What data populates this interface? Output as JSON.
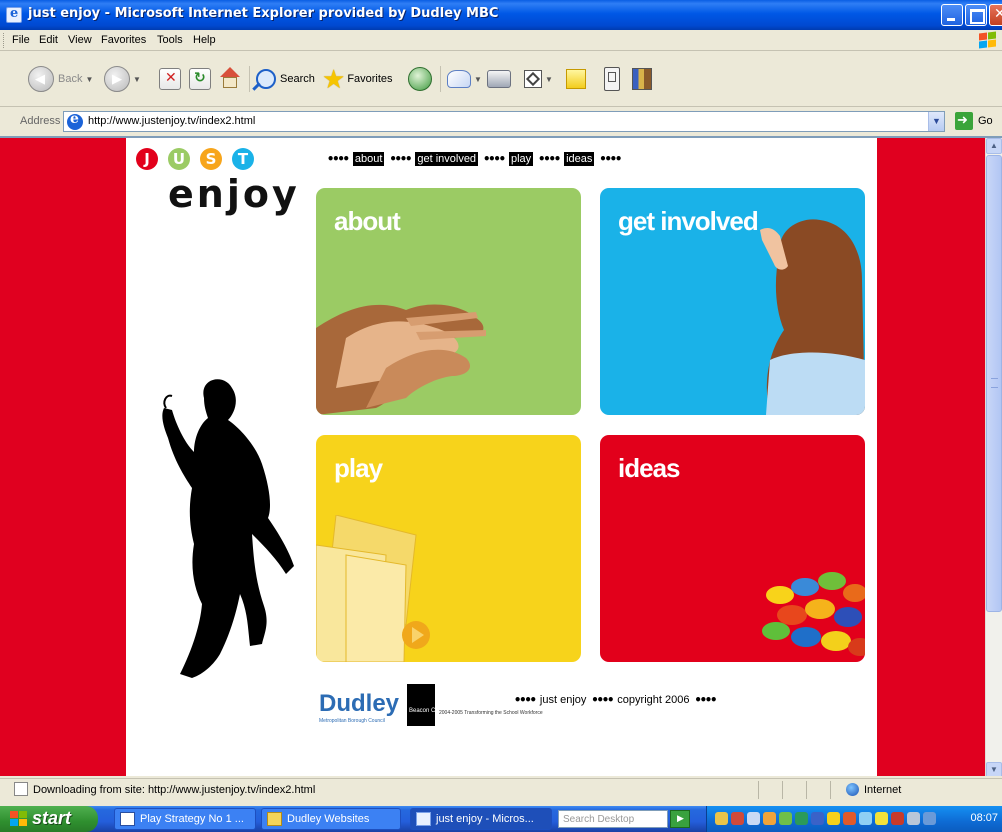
{
  "window": {
    "title": "just enjoy - Microsoft Internet Explorer provided by Dudley MBC"
  },
  "menu": [
    "File",
    "Edit",
    "View",
    "Favorites",
    "Tools",
    "Help"
  ],
  "toolbar": {
    "back_label": "Back",
    "search_label": "Search",
    "favorites_label": "Favorites"
  },
  "address": {
    "label": "Address",
    "url": "http://www.justenjoy.tv/index2.html",
    "go_label": "Go"
  },
  "site": {
    "logo_letters": [
      "J",
      "U",
      "S",
      "T"
    ],
    "logo_colors": [
      "#e2001b",
      "#9bcb64",
      "#f7a51b",
      "#1ab2e8"
    ],
    "logo_word": "enjoy",
    "nav": [
      "about",
      "get involved",
      "play",
      "ideas"
    ],
    "tiles": {
      "about": "about",
      "get_involved": "get involved",
      "play": "play",
      "ideas": "ideas"
    },
    "colors": {
      "background": "#e2001b",
      "about": "#9bcb64",
      "get_involved": "#1ab2e8",
      "play": "#f7d31b",
      "ideas": "#e2001b"
    },
    "footer": {
      "dudley": "Dudley",
      "dudley_sub": "Metropolitan Borough Council",
      "beacon": "Beacon Council",
      "beacon_years": "2004-2005",
      "beacon_sub": "Transforming the School Workforce",
      "just_enjoy": "just enjoy",
      "copyright": "copyright 2006"
    }
  },
  "status": {
    "text": "Downloading from site: http://www.justenjoy.tv/index2.html",
    "zone": "Internet"
  },
  "taskbar": {
    "start": "start",
    "tasks": [
      "Play Strategy No 1 ...",
      "Dudley Websites",
      "just enjoy - Micros..."
    ],
    "search_placeholder": "Search Desktop",
    "clock": "08:07"
  }
}
